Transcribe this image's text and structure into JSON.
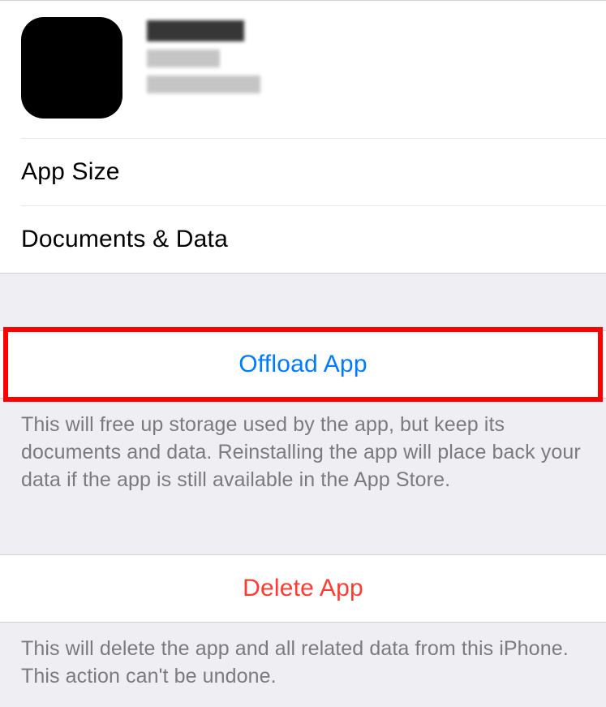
{
  "app": {
    "name": "",
    "subtitle1": "",
    "subtitle2": ""
  },
  "rows": {
    "app_size_label": "App Size",
    "documents_data_label": "Documents & Data"
  },
  "actions": {
    "offload_label": "Offload App",
    "offload_footer": "This will free up storage used by the app, but keep its documents and data. Reinstalling the app will place back your data if the app is still available in the App Store.",
    "delete_label": "Delete App",
    "delete_footer": "This will delete the app and all related data from this iPhone. This action can't be undone."
  }
}
